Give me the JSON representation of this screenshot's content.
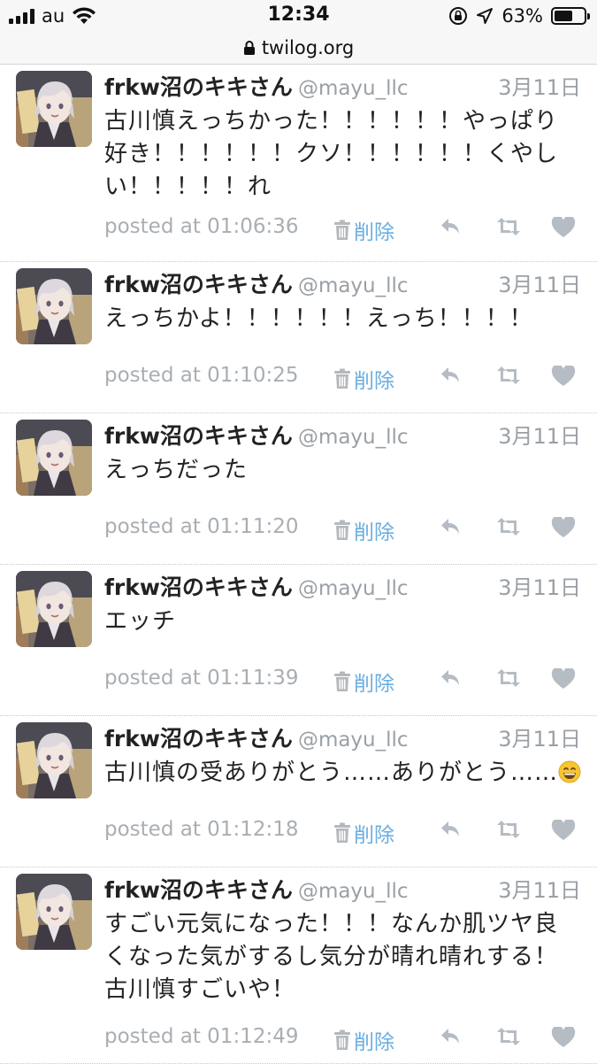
{
  "status_bar": {
    "carrier": "au",
    "time": "12:34",
    "battery_percent": "63%",
    "battery_level": 0.63
  },
  "browser": {
    "url": "twilog.org"
  },
  "tweet_common": {
    "display_name": "frkw沼のキキさん",
    "handle": "@mayu_llc",
    "posted_label": "posted at",
    "delete_label": "削除"
  },
  "tweets": [
    {
      "date": "3月11日",
      "text": "古川慎えっちかった！！！！！！やっぱり好き！！！！！！クソ！！！！！！くやしい！！！！！れ",
      "time": "01:06:36"
    },
    {
      "date": "3月11日",
      "text": "えっちかよ！！！！！！えっち！！！！",
      "time": "01:10:25"
    },
    {
      "date": "3月11日",
      "text": "えっちだった",
      "time": "01:11:20"
    },
    {
      "date": "3月11日",
      "text": "エッチ",
      "time": "01:11:39"
    },
    {
      "date": "3月11日",
      "text": "古川慎の受ありがとう……ありがとう……",
      "emoji": "grinning-face-emoji",
      "time": "01:12:18"
    },
    {
      "date": "3月11日",
      "text": "すごい元気になった！！！なんか肌ツヤ良くなった気がするし気分が晴れ晴れする！古川慎すごいや！",
      "time": "01:12:49"
    }
  ],
  "icons": {
    "delete": "trash-icon",
    "reply": "reply-icon",
    "retweet": "retweet-icon",
    "like": "heart-icon"
  }
}
